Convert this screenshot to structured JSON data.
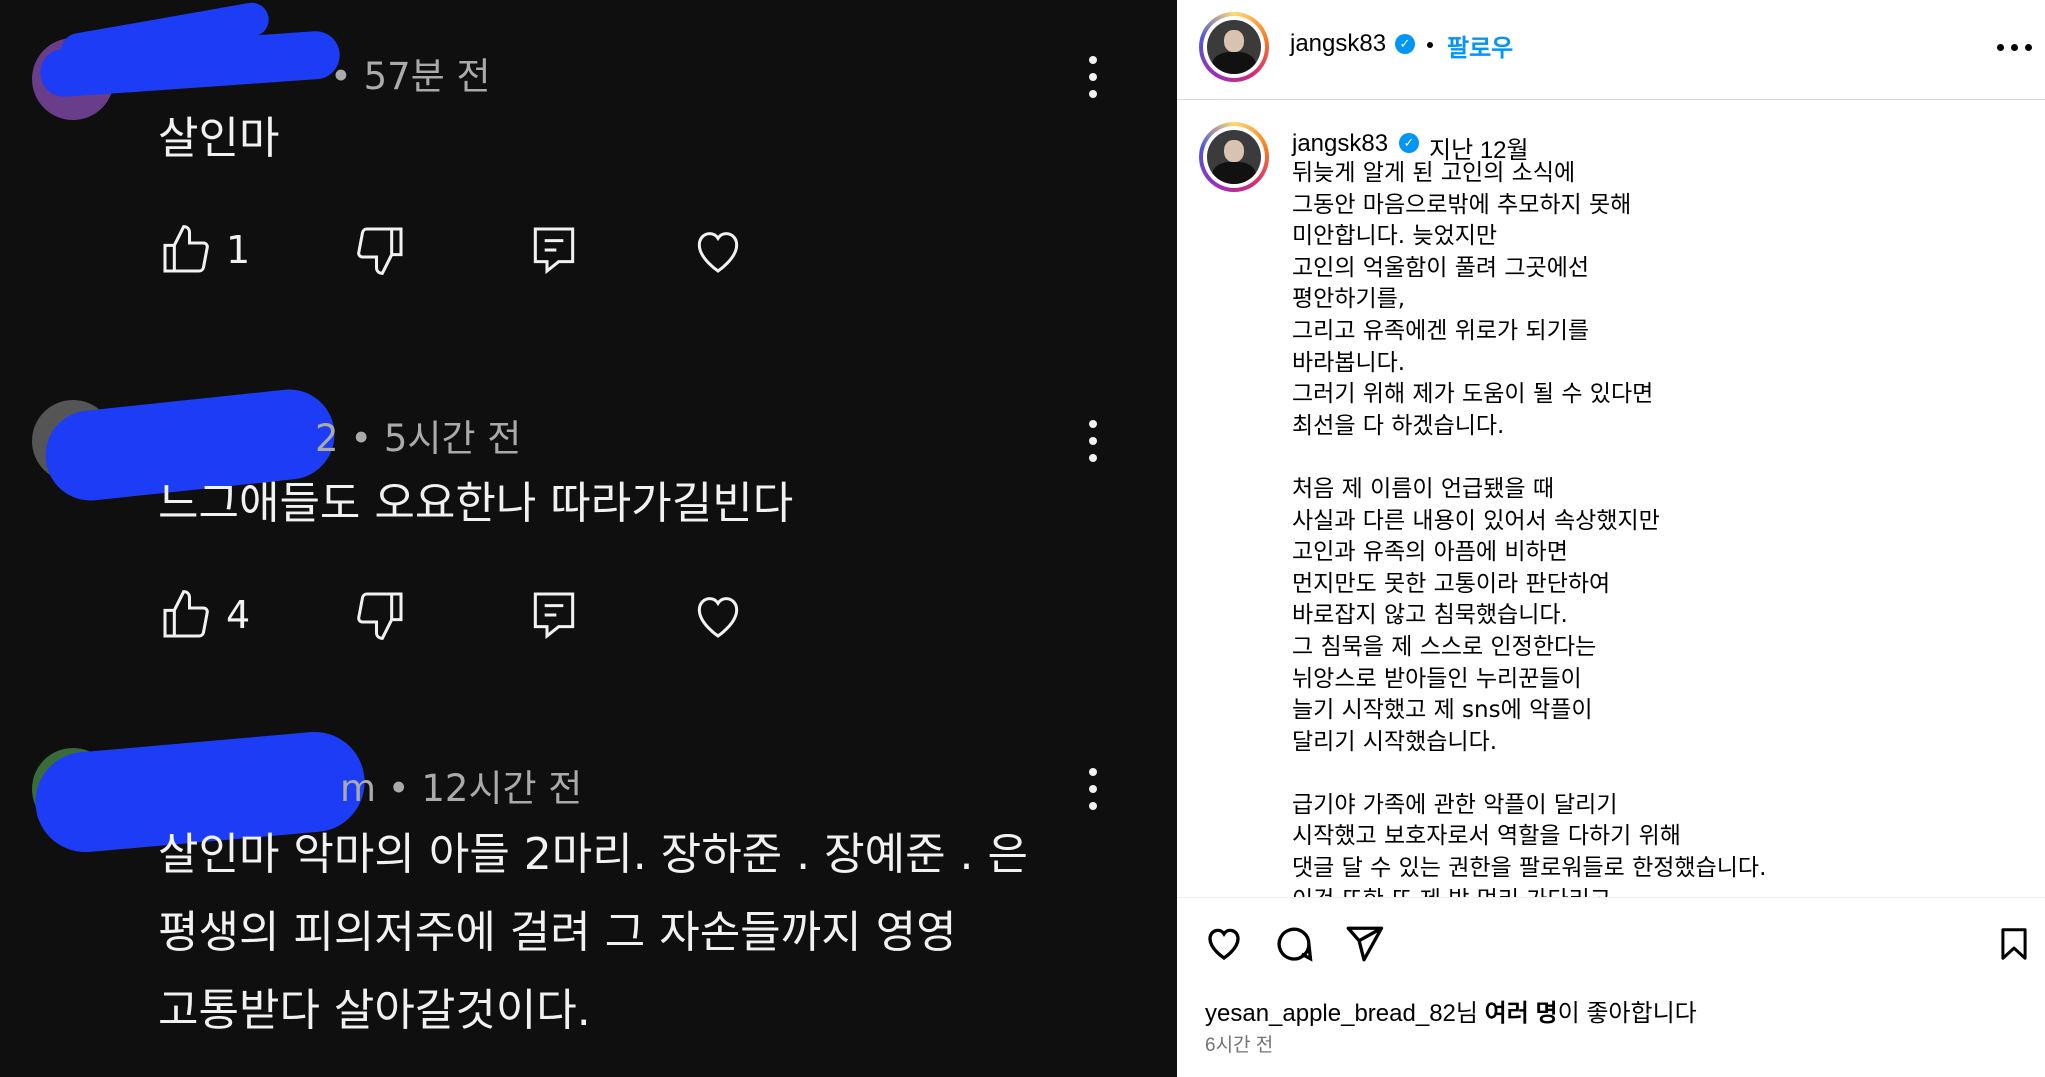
{
  "comments": [
    {
      "meta": "• 57분 전",
      "username": "",
      "text_lines": [
        "살인마"
      ],
      "likes": "1"
    },
    {
      "meta": "2 • 5시간 전",
      "username": "",
      "text_lines": [
        "느그애들도 오요한나 따라가길빈다"
      ],
      "likes": "4"
    },
    {
      "meta": "m • 12시간 전",
      "username": "",
      "text_lines": [
        "살인마 악마의 아들 2마리. 장하준 . 장예준 . 은",
        "평생의 피의저주에 걸려 그 자손들까지 영영",
        "고통받다 살아갈것이다."
      ]
    }
  ],
  "post": {
    "username": "jangsk83",
    "follow_label": "팔로우",
    "caption_username": "jangsk83",
    "caption_time": "지난 12월",
    "caption": "뒤늦게 알게 된 고인의 소식에\n그동안 마음으로밖에 추모하지 못해\n미안합니다. 늦었지만\n고인의 억울함이 풀려 그곳에선\n평안하기를,\n그리고 유족에겐 위로가 되기를\n바라봅니다.\n그러기 위해 제가 도움이 될 수 있다면\n최선을 다 하겠습니다.\n\n처음 제 이름이 언급됐을 때\n사실과 다른 내용이 있어서 속상했지만\n고인과 유족의 아픔에 비하면\n먼지만도 못한 고통이라 판단하여\n바로잡지 않고 침묵했습니다.\n그 침묵을 제 스스로 인정한다는\n뉘앙스로 받아들인 누리꾼들이\n늘기 시작했고 제 sns에 악플이\n달리기 시작했습니다.\n\n급기야 가족에 관한 악플이 달리기\n시작했고 보호자로서 역할을 다하기 위해\n댓글 달 수 있는 권한을 팔로워들로 한정했습니다.\n이건 또한 또 제 밥 먹리 가다리고",
    "likes_user": "yesan_apple_bread_82",
    "likes_suffix_1": "님",
    "likes_bold": "여러 명",
    "likes_suffix_2": "이 좋아합니다",
    "time": "6시간 전"
  },
  "colors": {
    "left_bg": "#0f0f0f",
    "blue_scribble": "#1c3df5",
    "instagram_blue": "#0095f6"
  }
}
